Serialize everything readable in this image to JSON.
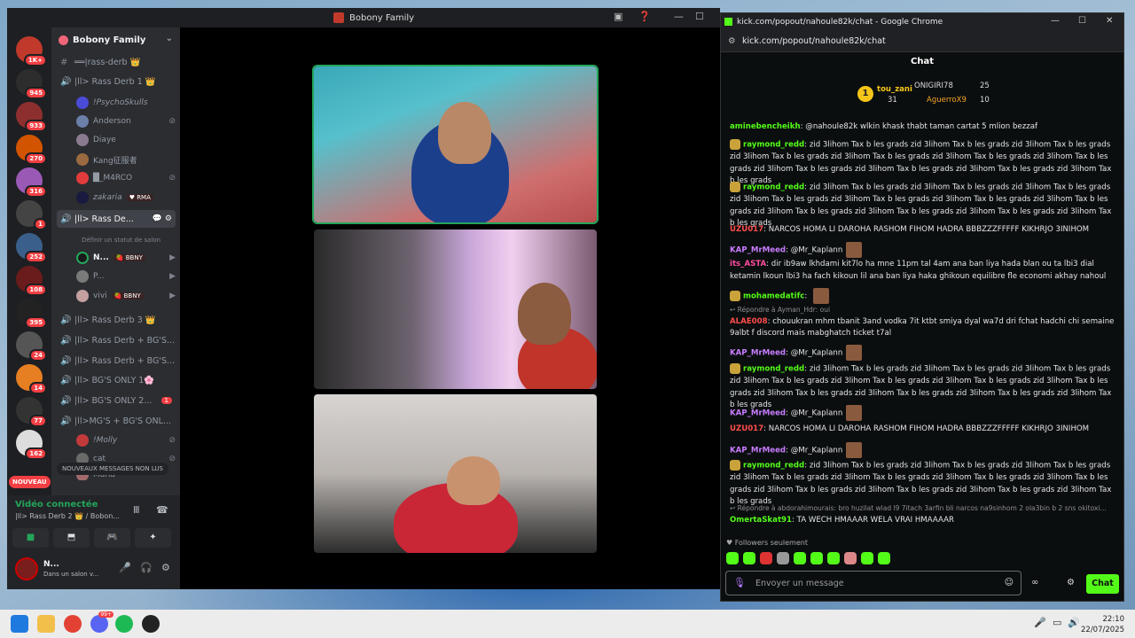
{
  "discord": {
    "title": "Bobony Family",
    "guild_name": "Bobony Family",
    "server_badges": [
      "1K+",
      "945",
      "933",
      "270",
      "316",
      "1",
      "252",
      "108",
      "395",
      "24",
      "14",
      "77",
      "162"
    ],
    "channels": [
      {
        "label": "══|rass-derb 👑",
        "icon": "#"
      },
      {
        "label": "|ll> Rass Derb 1 👑",
        "icon": "🔊"
      },
      {
        "label": "|ll> Rass De...",
        "icon": "🔊"
      },
      {
        "label": "|ll> Rass Derb 3 👑",
        "icon": "🔊"
      },
      {
        "label": "|ll> Rass Derb + BG'S...",
        "icon": "🔊"
      },
      {
        "label": "|ll> Rass Derb + BG'S...",
        "icon": "🔊"
      },
      {
        "label": "|ll> BG'S ONLY 1🌸",
        "icon": "🔊"
      },
      {
        "label": "|ll> BG'S ONLY 2...",
        "icon": "🔊",
        "badge": "1"
      },
      {
        "label": "|ll>MG'S + BG'S ONL...",
        "icon": "🔊"
      }
    ],
    "users_derb1": [
      "!PsychoSkulls",
      "Anderson",
      "Diaye",
      "Kang征服者",
      "█_M4RCO",
      "zakaria"
    ],
    "zakaria_tag": "♥ RMA",
    "users_active": [
      "N...",
      "P...",
      "vivi"
    ],
    "bbny_tag": "🍓 BBNY",
    "users_mg": [
      "!Molly",
      "cat",
      "Maria"
    ],
    "status_hint": "Définir un statut de salon",
    "new_messages": "NOUVEAUX MESSAGES NON LUS",
    "nouveau": "NOUVEAU",
    "voice_connected": "Vidéo connectée",
    "voice_where": "|ll> Rass Derb 2 👑 / Bobon...",
    "me_name": "N...",
    "me_status": "Dans un salon v..."
  },
  "chrome": {
    "title": "kick.com/popout/nahoule82k/chat - Google Chrome",
    "url": "kick.com/popout/nahoule82k/chat",
    "chat_header": "Chat",
    "top": [
      {
        "rank": "1",
        "name": "tou_zani",
        "count": "31"
      },
      {
        "name": "ONIGIRI78",
        "count": "25"
      },
      {
        "name": "AguerroX9",
        "count": "10"
      }
    ],
    "messages": [
      {
        "user": "aminebencheikh",
        "color": "#53fc18",
        "text": "@nahoule82k wlkin khask thabt taman cartat 5 mlion bezzaf"
      },
      {
        "user": "raymond_redd",
        "color": "#53fc18",
        "badge": true,
        "text": "zid 3lihom Tax b les grads zid 3lihom Tax b les grads zid 3lihom Tax b les grads zid 3lihom Tax b les grads zid 3lihom Tax b les grads zid 3lihom Tax b les grads zid 3lihom Tax b les grads zid 3lihom Tax b les grads zid 3lihom Tax b les grads zid 3lihom Tax b les grads zid 3lihom Tax b les grads"
      },
      {
        "user": "raymond_redd",
        "color": "#53fc18",
        "badge": true,
        "text": "zid 3lihom Tax b les grads zid 3lihom Tax b les grads zid 3lihom Tax b les grads zid 3lihom Tax b les grads zid 3lihom Tax b les grads zid 3lihom Tax b les grads zid 3lihom Tax b les grads zid 3lihom Tax b les grads zid 3lihom Tax b les grads zid 3lihom Tax b les grads zid 3lihom Tax b les grads"
      },
      {
        "user": "UZU017",
        "color": "#ff4d4d",
        "text": "NARCOS HOMA LI DAROHA RASHOM FIHOM HADRA BBBZZZFFFFF KIKHRJO 3INIHOM"
      },
      {
        "user": "KAP_MrMeed",
        "color": "#c77dff",
        "text": "@Mr_Kaplann"
      },
      {
        "user": "its_ASTA",
        "color": "#ff4d9e",
        "text": "dir ib9aw lkhdami kit7lo ha mne 11pm tal 4am ana ban liya hada blan ou ta lbi3 dial ketamin lkoun lbi3 ha fach kikoun lil ana ban liya haka ghikoun equilibre fle economi akhay nahoul"
      },
      {
        "user": "mohamedatifc",
        "color": "#53fc18",
        "badge": true,
        "text": ""
      },
      {
        "reply": "Répondre à Ayman_Hdr: oui",
        "user": "ALAE008",
        "color": "#ff4d4d",
        "text": "chouukran mhm tbanit 3and vodka 7it ktbt smiya dyal wa7d dri fchat hadchi chi semaine 9albt f discord mais mabghatch ticket t7al"
      },
      {
        "user": "KAP_MrMeed",
        "color": "#c77dff",
        "text": "@Mr_Kaplann"
      },
      {
        "user": "raymond_redd",
        "color": "#53fc18",
        "badge": true,
        "text": "zid 3lihom Tax b les grads zid 3lihom Tax b les grads zid 3lihom Tax b les grads zid 3lihom Tax b les grads zid 3lihom Tax b les grads zid 3lihom Tax b les grads zid 3lihom Tax b les grads zid 3lihom Tax b les grads zid 3lihom Tax b les grads zid 3lihom Tax b les grads zid 3lihom Tax b les grads"
      },
      {
        "user": "KAP_MrMeed",
        "color": "#c77dff",
        "text": "@Mr_Kaplann"
      },
      {
        "user": "UZU017",
        "color": "#ff4d4d",
        "text": "NARCOS HOMA LI DAROHA RASHOM FIHOM HADRA BBBZZZFFFFF KIKHRJO 3INIHOM"
      },
      {
        "user": "KAP_MrMeed",
        "color": "#c77dff",
        "text": "@Mr_Kaplann"
      },
      {
        "user": "raymond_redd",
        "color": "#53fc18",
        "badge": true,
        "text": "zid 3lihom Tax b les grads zid 3lihom Tax b les grads zid 3lihom Tax b les grads zid 3lihom Tax b les grads zid 3lihom Tax b les grads zid 3lihom Tax b les grads zid 3lihom Tax b les grads zid 3lihom Tax b les grads zid 3lihom Tax b les grads zid 3lihom Tax b les grads zid 3lihom Tax b les grads"
      },
      {
        "reply": "Répondre à abdorahimourais: bro huzilat wlad l9 7itach 3arfin bli narcos na9sinhom 2 ola3bin b 2 sns okitoxi...",
        "user": "OmertaSkat91",
        "color": "#53fc18",
        "text": "TA WECH HMAAAR WELA VRAI HMAAAAR"
      }
    ],
    "followers_only": "Followers seulement",
    "input_placeholder": "Envoyer un message",
    "chat_button": "Chat"
  },
  "taskbar": {
    "time": "22:10",
    "date": "22/07/2025",
    "discord_badge": "99+"
  },
  "colors": {
    "kick_green": "#53fc18",
    "discord_bg": "#2b2d31",
    "speaking": "#23a55a"
  }
}
